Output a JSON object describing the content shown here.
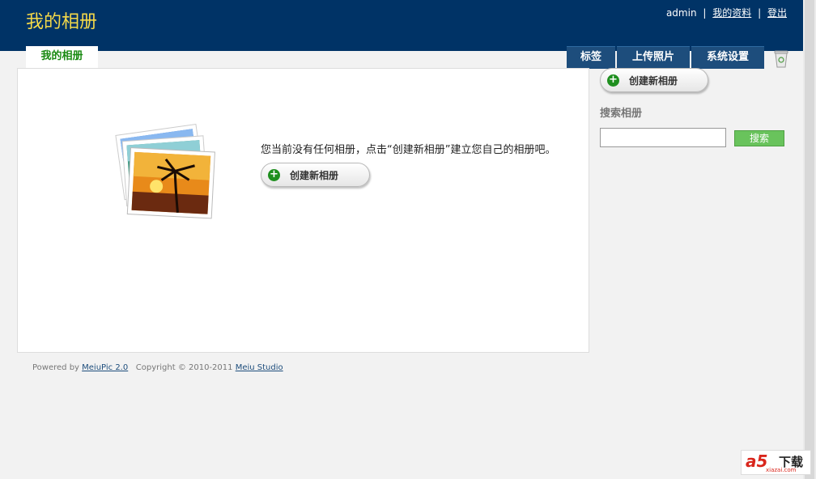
{
  "header": {
    "title": "我的相册",
    "user": "admin",
    "profile_link": "我的资料",
    "logout_link": "登出",
    "separator": "|"
  },
  "tabs": {
    "active": "我的相册",
    "items": [
      "标签",
      "上传照片",
      "系统设置"
    ]
  },
  "main": {
    "empty_message": "您当前没有任何相册，点击“创建新相册”建立您自己的相册吧。",
    "create_button": "创建新相册"
  },
  "sidebar": {
    "create_button": "创建新相册",
    "search_label": "搜索相册",
    "search_value": "",
    "search_button": "搜索"
  },
  "footer": {
    "powered_prefix": "Powered by",
    "powered_link": "MeiuPic 2.0",
    "copyright": "Copyright © 2010-2011",
    "studio_link": "Meiu Studio"
  },
  "badge": {
    "logo": "a5",
    "label": "下载",
    "domain": "xiazai.com"
  },
  "colors": {
    "header_bg": "#003366",
    "title": "#f5d949",
    "tab_bg": "#1d4d7c",
    "active_tab_text": "#1a8a12",
    "search_button": "#69c35c"
  }
}
